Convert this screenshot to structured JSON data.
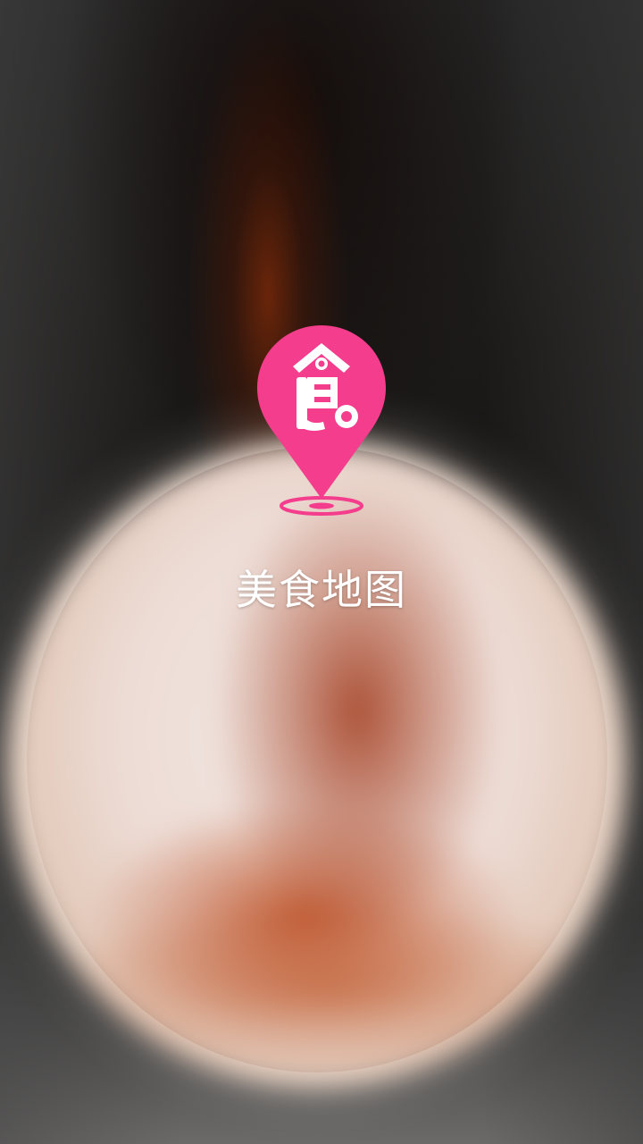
{
  "app": {
    "title": "美食地图",
    "logo_icon": "map-pin-food-icon",
    "logo_glyph": "食"
  },
  "colors": {
    "brand_pink": "#f43d8c",
    "title_text": "#ffffff"
  }
}
